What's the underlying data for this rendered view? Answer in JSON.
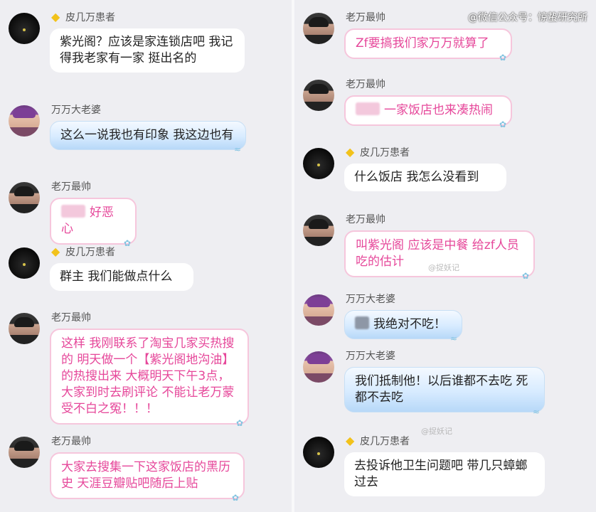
{
  "watermark": "@微信公众号：惊蛰研究所",
  "inline_watermarks": [
    "@捉妖记",
    "@捉妖记"
  ],
  "colors": {
    "badge": "#f2c21b",
    "pink_text": "#e6479a",
    "blue_bubble": "#d7ebff"
  },
  "left_messages": [
    {
      "sender": "皮几万患者",
      "avatar": "dark-avatar",
      "badge": "gold-diamond",
      "style": "white",
      "text": "紫光阁？应该是家连锁店吧 我记得我老家有一家 挺出名的"
    },
    {
      "sender": "万万大老婆",
      "avatar": "girl-avatar",
      "style": "blue",
      "text": "这么一说我也有印象 我这边也有"
    },
    {
      "sender": "老万最帅",
      "avatar": "man-avatar",
      "style": "pink",
      "text": "好恶心"
    },
    {
      "sender": "皮几万患者",
      "avatar": "dark-avatar",
      "badge": "gold-diamond",
      "style": "white",
      "text": "群主 我们能做点什么"
    },
    {
      "sender": "老万最帅",
      "avatar": "man-avatar",
      "style": "pink",
      "text": "这样 我刚联系了淘宝几家买热搜的 明天做一个【紫光阁地沟油】的热搜出来 大概明天下午3点，大家到时去刷评论 不能让老万蒙受不白之冤！！！"
    },
    {
      "sender": "老万最帅",
      "avatar": "man-avatar",
      "style": "pink",
      "text": "大家去搜集一下这家饭店的黑历史 天涯豆瓣贴吧随后上贴"
    }
  ],
  "right_messages": [
    {
      "sender": "老万最帅",
      "avatar": "man-avatar",
      "style": "pink",
      "text": "Zf要搞我们家万万就算了"
    },
    {
      "sender": "老万最帅",
      "avatar": "man-avatar",
      "style": "pink",
      "text": "一家饭店也来凑热闹"
    },
    {
      "sender": "皮几万患者",
      "avatar": "dark-avatar",
      "badge": "gold-diamond",
      "style": "white",
      "text": "什么饭店 我怎么没看到"
    },
    {
      "sender": "老万最帅",
      "avatar": "man-avatar",
      "style": "pink",
      "text": "叫紫光阁 应该是中餐 给zf人员吃的估计"
    },
    {
      "sender": "万万大老婆",
      "avatar": "girl-avatar",
      "style": "blue",
      "text": "我绝对不吃！"
    },
    {
      "sender": "万万大老婆",
      "avatar": "girl-avatar",
      "style": "blue",
      "text": "我们抵制他！以后谁都不去吃 死都不去吃"
    },
    {
      "sender": "皮几万患者",
      "avatar": "dark-avatar",
      "badge": "gold-diamond",
      "style": "white",
      "text": "去投诉他卫生问题吧 带几只蟑螂过去"
    }
  ]
}
